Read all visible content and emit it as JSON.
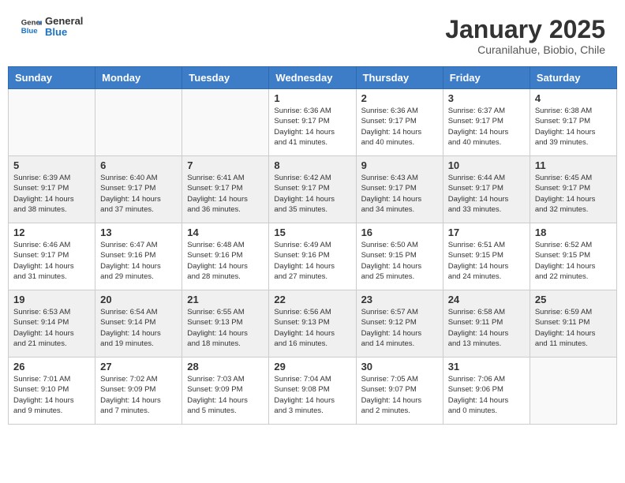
{
  "logo": {
    "line1": "General",
    "line2": "Blue"
  },
  "title": "January 2025",
  "subtitle": "Curanilahue, Biobio, Chile",
  "weekdays": [
    "Sunday",
    "Monday",
    "Tuesday",
    "Wednesday",
    "Thursday",
    "Friday",
    "Saturday"
  ],
  "weeks": [
    [
      {
        "day": "",
        "info": ""
      },
      {
        "day": "",
        "info": ""
      },
      {
        "day": "",
        "info": ""
      },
      {
        "day": "1",
        "info": "Sunrise: 6:36 AM\nSunset: 9:17 PM\nDaylight: 14 hours\nand 41 minutes."
      },
      {
        "day": "2",
        "info": "Sunrise: 6:36 AM\nSunset: 9:17 PM\nDaylight: 14 hours\nand 40 minutes."
      },
      {
        "day": "3",
        "info": "Sunrise: 6:37 AM\nSunset: 9:17 PM\nDaylight: 14 hours\nand 40 minutes."
      },
      {
        "day": "4",
        "info": "Sunrise: 6:38 AM\nSunset: 9:17 PM\nDaylight: 14 hours\nand 39 minutes."
      }
    ],
    [
      {
        "day": "5",
        "info": "Sunrise: 6:39 AM\nSunset: 9:17 PM\nDaylight: 14 hours\nand 38 minutes."
      },
      {
        "day": "6",
        "info": "Sunrise: 6:40 AM\nSunset: 9:17 PM\nDaylight: 14 hours\nand 37 minutes."
      },
      {
        "day": "7",
        "info": "Sunrise: 6:41 AM\nSunset: 9:17 PM\nDaylight: 14 hours\nand 36 minutes."
      },
      {
        "day": "8",
        "info": "Sunrise: 6:42 AM\nSunset: 9:17 PM\nDaylight: 14 hours\nand 35 minutes."
      },
      {
        "day": "9",
        "info": "Sunrise: 6:43 AM\nSunset: 9:17 PM\nDaylight: 14 hours\nand 34 minutes."
      },
      {
        "day": "10",
        "info": "Sunrise: 6:44 AM\nSunset: 9:17 PM\nDaylight: 14 hours\nand 33 minutes."
      },
      {
        "day": "11",
        "info": "Sunrise: 6:45 AM\nSunset: 9:17 PM\nDaylight: 14 hours\nand 32 minutes."
      }
    ],
    [
      {
        "day": "12",
        "info": "Sunrise: 6:46 AM\nSunset: 9:17 PM\nDaylight: 14 hours\nand 31 minutes."
      },
      {
        "day": "13",
        "info": "Sunrise: 6:47 AM\nSunset: 9:16 PM\nDaylight: 14 hours\nand 29 minutes."
      },
      {
        "day": "14",
        "info": "Sunrise: 6:48 AM\nSunset: 9:16 PM\nDaylight: 14 hours\nand 28 minutes."
      },
      {
        "day": "15",
        "info": "Sunrise: 6:49 AM\nSunset: 9:16 PM\nDaylight: 14 hours\nand 27 minutes."
      },
      {
        "day": "16",
        "info": "Sunrise: 6:50 AM\nSunset: 9:15 PM\nDaylight: 14 hours\nand 25 minutes."
      },
      {
        "day": "17",
        "info": "Sunrise: 6:51 AM\nSunset: 9:15 PM\nDaylight: 14 hours\nand 24 minutes."
      },
      {
        "day": "18",
        "info": "Sunrise: 6:52 AM\nSunset: 9:15 PM\nDaylight: 14 hours\nand 22 minutes."
      }
    ],
    [
      {
        "day": "19",
        "info": "Sunrise: 6:53 AM\nSunset: 9:14 PM\nDaylight: 14 hours\nand 21 minutes."
      },
      {
        "day": "20",
        "info": "Sunrise: 6:54 AM\nSunset: 9:14 PM\nDaylight: 14 hours\nand 19 minutes."
      },
      {
        "day": "21",
        "info": "Sunrise: 6:55 AM\nSunset: 9:13 PM\nDaylight: 14 hours\nand 18 minutes."
      },
      {
        "day": "22",
        "info": "Sunrise: 6:56 AM\nSunset: 9:13 PM\nDaylight: 14 hours\nand 16 minutes."
      },
      {
        "day": "23",
        "info": "Sunrise: 6:57 AM\nSunset: 9:12 PM\nDaylight: 14 hours\nand 14 minutes."
      },
      {
        "day": "24",
        "info": "Sunrise: 6:58 AM\nSunset: 9:11 PM\nDaylight: 14 hours\nand 13 minutes."
      },
      {
        "day": "25",
        "info": "Sunrise: 6:59 AM\nSunset: 9:11 PM\nDaylight: 14 hours\nand 11 minutes."
      }
    ],
    [
      {
        "day": "26",
        "info": "Sunrise: 7:01 AM\nSunset: 9:10 PM\nDaylight: 14 hours\nand 9 minutes."
      },
      {
        "day": "27",
        "info": "Sunrise: 7:02 AM\nSunset: 9:09 PM\nDaylight: 14 hours\nand 7 minutes."
      },
      {
        "day": "28",
        "info": "Sunrise: 7:03 AM\nSunset: 9:09 PM\nDaylight: 14 hours\nand 5 minutes."
      },
      {
        "day": "29",
        "info": "Sunrise: 7:04 AM\nSunset: 9:08 PM\nDaylight: 14 hours\nand 3 minutes."
      },
      {
        "day": "30",
        "info": "Sunrise: 7:05 AM\nSunset: 9:07 PM\nDaylight: 14 hours\nand 2 minutes."
      },
      {
        "day": "31",
        "info": "Sunrise: 7:06 AM\nSunset: 9:06 PM\nDaylight: 14 hours\nand 0 minutes."
      },
      {
        "day": "",
        "info": ""
      }
    ]
  ]
}
